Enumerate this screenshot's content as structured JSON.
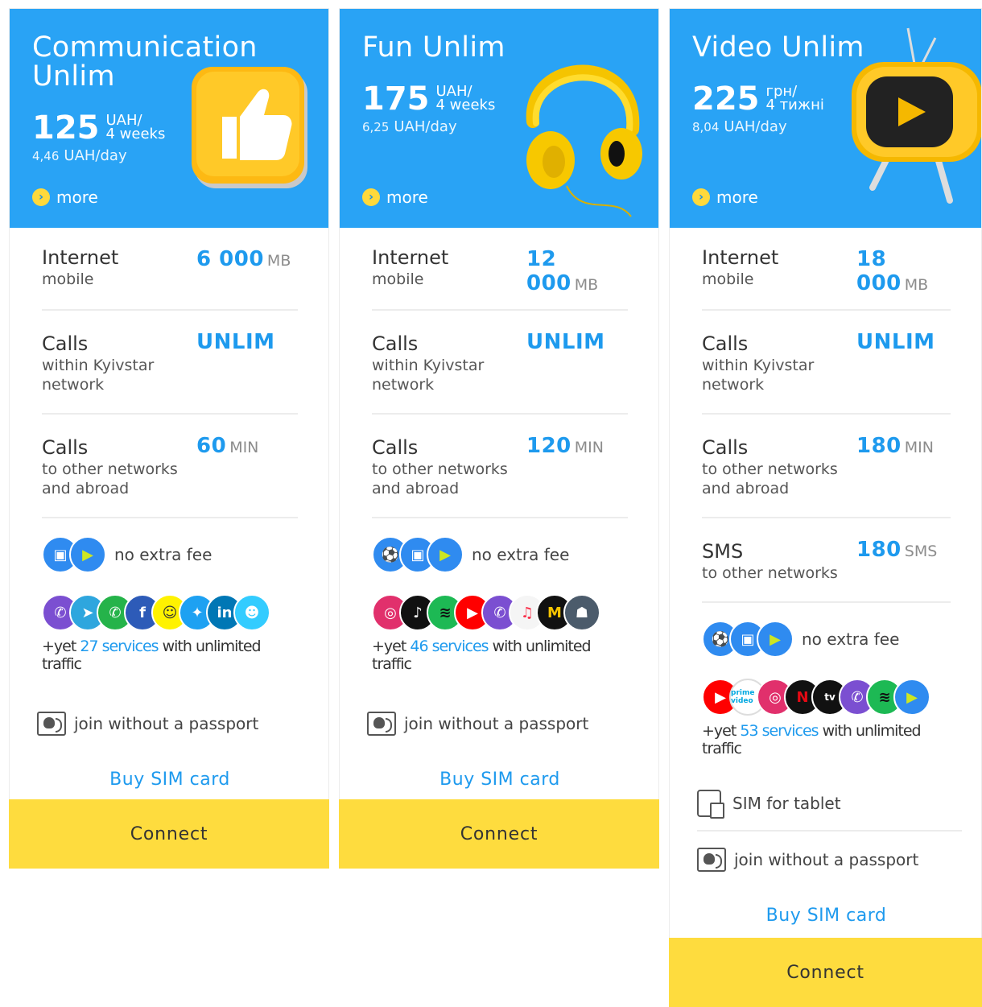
{
  "colors": {
    "header": "#29a3f5",
    "accent": "#1e9aee",
    "connect": "#fedc3e"
  },
  "cards": [
    {
      "title": "Communication Unlim",
      "price": "125",
      "currency": "UAH/",
      "period": "4 weeks",
      "daily_value": "4,46",
      "daily_unit": "UAH/day",
      "more": "more",
      "rows": [
        {
          "label": "Internet",
          "sub": "mobile",
          "value": "6 000",
          "unit": "MB"
        },
        {
          "label": "Calls",
          "sub": "within Kyivstar network",
          "value": "UNLIM",
          "unit": ""
        },
        {
          "label": "Calls",
          "sub": "to other networks and abroad",
          "value": "60",
          "unit": "MIN"
        }
      ],
      "nofee_icons": [
        "kyivstar-tv-icon",
        "play-icon"
      ],
      "nofee_text": "no extra fee",
      "service_icons": [
        "viber-icon",
        "telegram-icon",
        "whatsapp-icon",
        "facebook-icon",
        "snapchat-icon",
        "twitter-icon",
        "linkedin-icon",
        "waze-icon"
      ],
      "yet_prefix": "+yet",
      "yet_link": "27 services",
      "yet_suffix": "with unlimited traffic",
      "passport": "join without a passport",
      "buy": "Buy SIM card",
      "connect": "Connect"
    },
    {
      "title": "Fun Unlim",
      "price": "175",
      "currency": "UAH/",
      "period": "4 weeks",
      "daily_value": "6,25",
      "daily_unit": "UAH/day",
      "more": "more",
      "rows": [
        {
          "label": "Internet",
          "sub": "mobile",
          "value": "12 000",
          "unit": "MB"
        },
        {
          "label": "Calls",
          "sub": "within Kyivstar network",
          "value": "UNLIM",
          "unit": ""
        },
        {
          "label": "Calls",
          "sub": "to other networks and abroad",
          "value": "120",
          "unit": "MIN"
        }
      ],
      "nofee_icons": [
        "football-icon",
        "kyivstar-tv-icon",
        "play-icon"
      ],
      "nofee_text": "no extra fee",
      "service_icons": [
        "instagram-icon",
        "tiktok-icon",
        "spotify-icon",
        "youtube-icon",
        "viber-icon",
        "apple-music-icon",
        "game-icon",
        "pubg-icon"
      ],
      "yet_prefix": "+yet",
      "yet_link": "46 services",
      "yet_suffix": "with unlimited traffic",
      "passport": "join without a passport",
      "buy": "Buy SIM card",
      "connect": "Connect"
    },
    {
      "title": "Video Unlim",
      "price": "225",
      "currency": "грн/",
      "period": "4 тижні",
      "daily_value": "8,04",
      "daily_unit": "UAH/day",
      "more": "more",
      "rows": [
        {
          "label": "Internet",
          "sub": "mobile",
          "value": "18 000",
          "unit": "MB"
        },
        {
          "label": "Calls",
          "sub": "within Kyivstar network",
          "value": "UNLIM",
          "unit": ""
        },
        {
          "label": "Calls",
          "sub": "to other networks and abroad",
          "value": "180",
          "unit": "MIN"
        },
        {
          "label": "SMS",
          "sub": "to other networks",
          "value": "180",
          "unit": "SMS"
        }
      ],
      "nofee_icons": [
        "football-icon",
        "kyivstar-tv-icon",
        "play-icon"
      ],
      "nofee_text": "no extra fee",
      "service_icons": [
        "youtube-icon",
        "prime-video-icon",
        "instagram-icon",
        "netflix-icon",
        "apple-tv-icon",
        "viber-icon",
        "spotify-icon",
        "play-icon"
      ],
      "prime_label": "prime video",
      "tv_label": "tv",
      "yet_prefix": "+yet",
      "yet_link": "53 services",
      "yet_suffix": "with unlimited traffic",
      "tablet": "SIM for tablet",
      "passport": "join without a passport",
      "buy": "Buy SIM card",
      "connect": "Connect"
    }
  ]
}
